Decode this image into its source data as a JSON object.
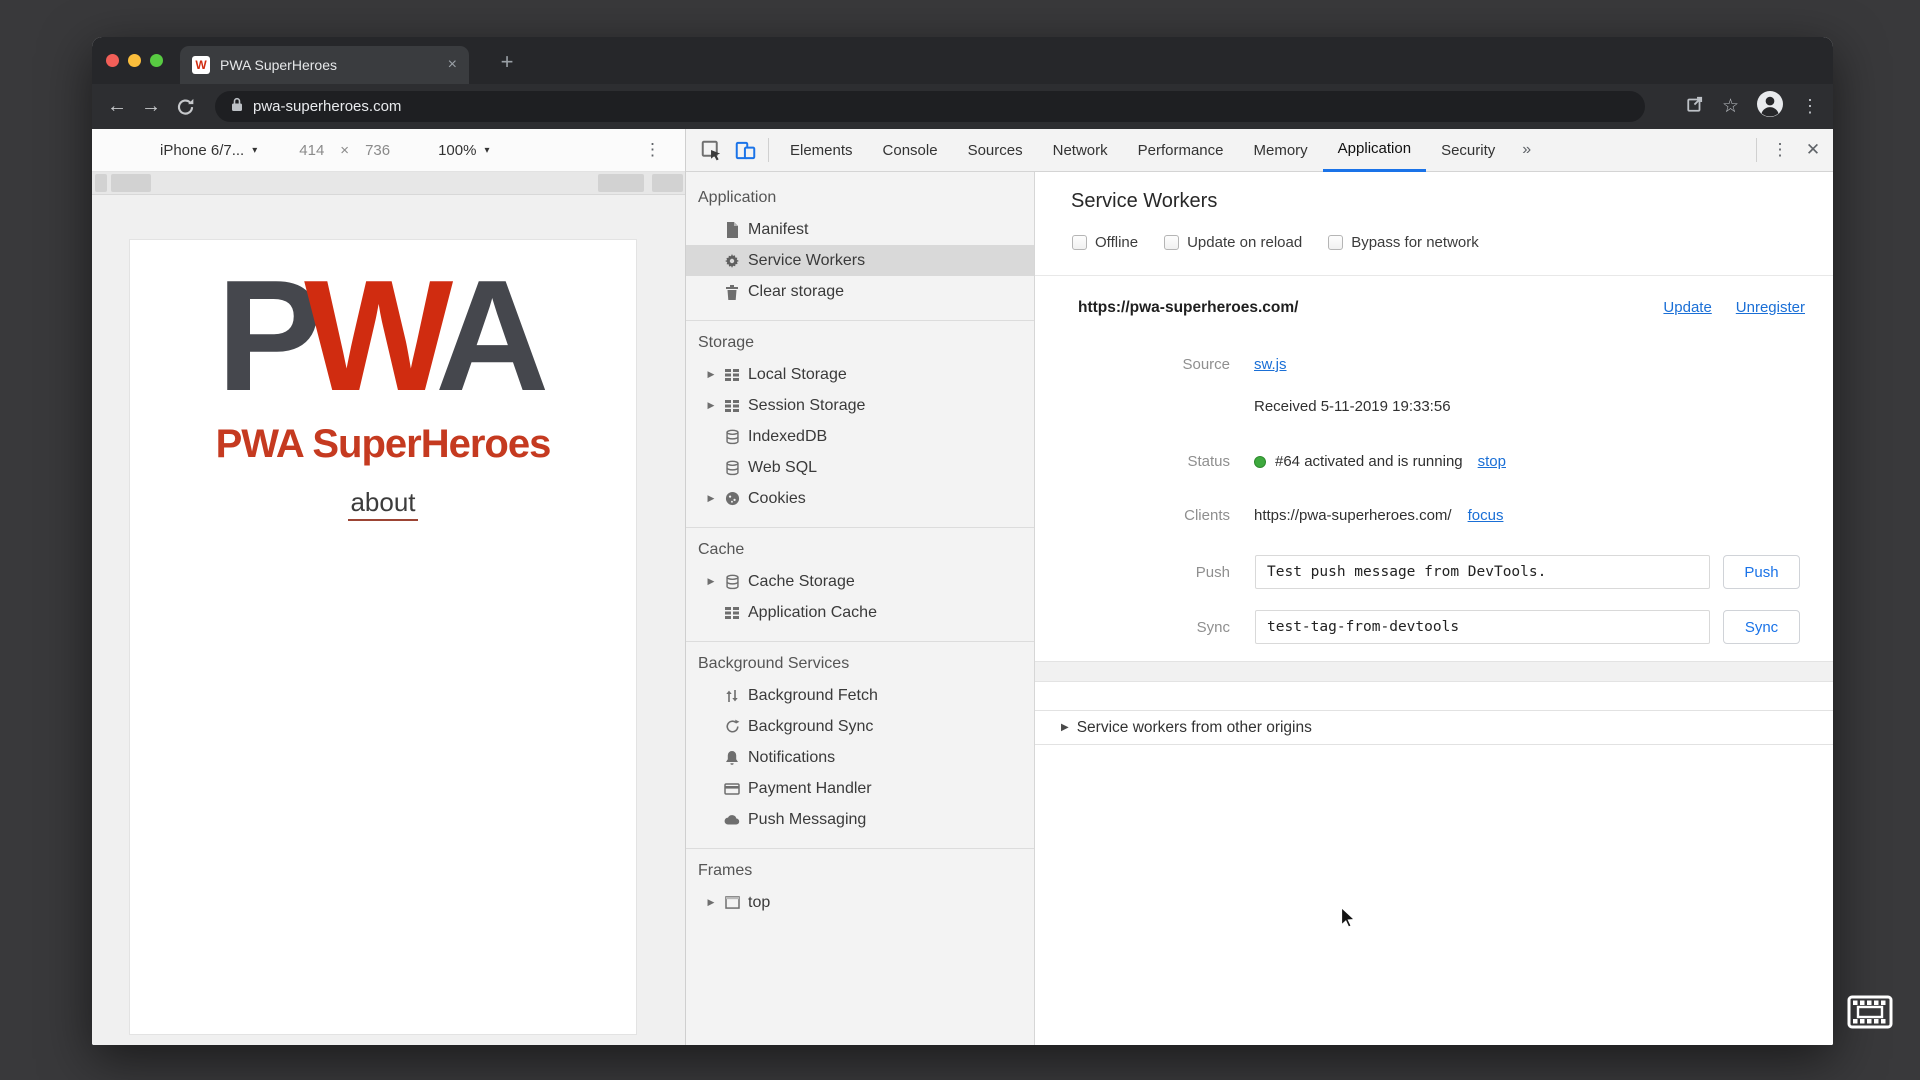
{
  "browser": {
    "tab_title": "PWA SuperHeroes",
    "favicon_glyph": "W",
    "url": "pwa-superheroes.com"
  },
  "device_bar": {
    "device": "iPhone 6/7...",
    "width": "414",
    "times": "×",
    "height": "736",
    "zoom": "100%"
  },
  "glyphs": {
    "back": "←",
    "forward": "→",
    "star": "☆",
    "menu": "⋮",
    "close": "✕",
    "tab_close": "×",
    "plus": "+",
    "more": "»",
    "dropdown": "▾",
    "expand": "▶"
  },
  "devtools": {
    "tabs": [
      "Elements",
      "Console",
      "Sources",
      "Network",
      "Performance",
      "Memory",
      "Application",
      "Security"
    ],
    "sidebar": {
      "sections": [
        {
          "title": "Application",
          "items": [
            {
              "label": "Manifest"
            },
            {
              "label": "Service Workers"
            },
            {
              "label": "Clear storage"
            }
          ]
        },
        {
          "title": "Storage",
          "items": [
            {
              "label": "Local Storage"
            },
            {
              "label": "Session Storage"
            },
            {
              "label": "IndexedDB"
            },
            {
              "label": "Web SQL"
            },
            {
              "label": "Cookies"
            }
          ]
        },
        {
          "title": "Cache",
          "items": [
            {
              "label": "Cache Storage"
            },
            {
              "label": "Application Cache"
            }
          ]
        },
        {
          "title": "Background Services",
          "items": [
            {
              "label": "Background Fetch"
            },
            {
              "label": "Background Sync"
            },
            {
              "label": "Notifications"
            },
            {
              "label": "Payment Handler"
            },
            {
              "label": "Push Messaging"
            }
          ]
        },
        {
          "title": "Frames",
          "items": [
            {
              "label": "top"
            }
          ]
        }
      ]
    },
    "panel": {
      "title": "Service Workers",
      "checkboxes": [
        "Offline",
        "Update on reload",
        "Bypass for network"
      ],
      "worker": {
        "origin": "https://pwa-superheroes.com/",
        "update_link": "Update",
        "unregister_link": "Unregister",
        "source_label": "Source",
        "source_link": "sw.js",
        "received": "Received 5-11-2019 19:33:56",
        "status_label": "Status",
        "status_text": "#64 activated and is running",
        "stop_link": "stop",
        "clients_label": "Clients",
        "clients_url": "https://pwa-superheroes.com/",
        "focus_link": "focus",
        "push_label": "Push",
        "push_value": "Test push message from DevTools.",
        "push_button": "Push",
        "sync_label": "Sync",
        "sync_value": "test-tag-from-devtools",
        "sync_button": "Sync"
      },
      "other_origins": "Service workers from other origins"
    }
  },
  "page": {
    "logo_p": "P",
    "logo_w": "W",
    "logo_a": "A",
    "title": "PWA SuperHeroes",
    "about": "about"
  },
  "colors": {
    "accent_blue": "#1a73e8",
    "logo_red": "#d02c10",
    "title_red": "#c53a20",
    "status_green": "#3ea93e"
  }
}
